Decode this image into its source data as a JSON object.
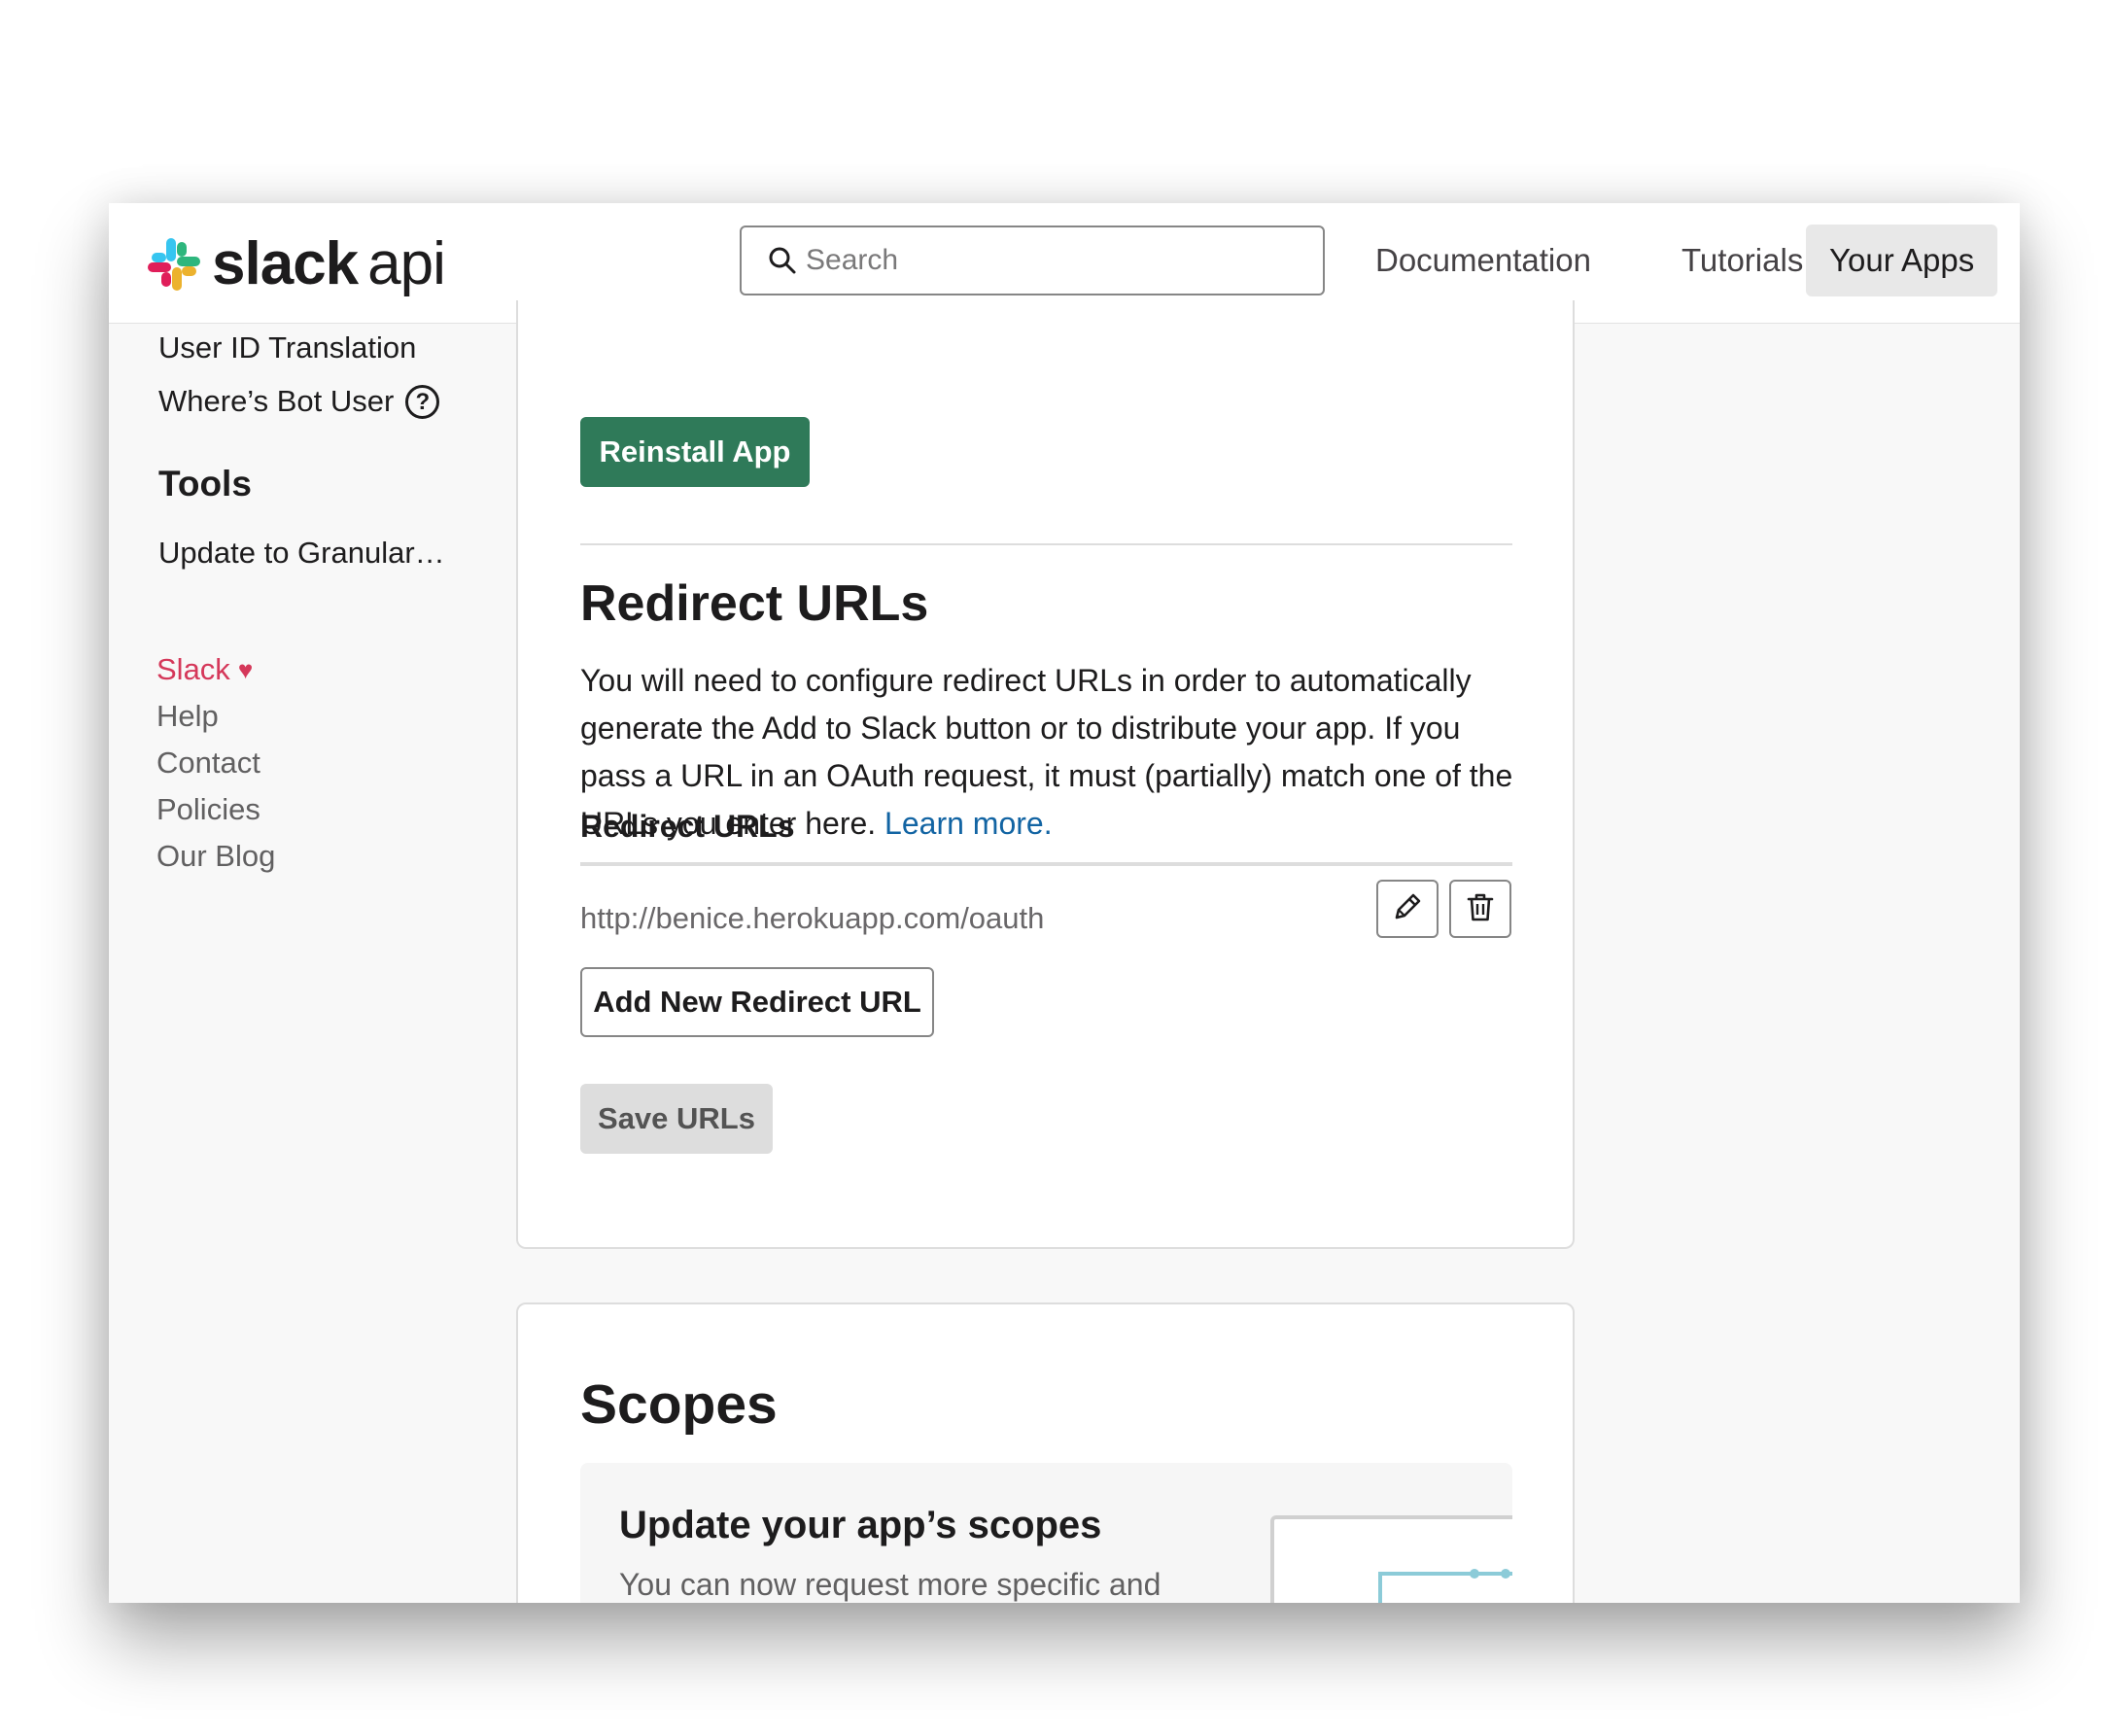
{
  "header": {
    "logo_brand": "slack",
    "logo_suffix": "api",
    "search_placeholder": "Search",
    "nav": {
      "documentation": "Documentation",
      "tutorials": "Tutorials",
      "your_apps": "Your Apps"
    }
  },
  "sidebar": {
    "items": {
      "user_id_translation": "User ID Translation",
      "wheres_bot_user": "Where’s Bot User",
      "help_icon": "?"
    },
    "tools_heading": "Tools",
    "tools_items": {
      "update_granular": "Update to Granular…"
    },
    "footer": {
      "slack": "Slack",
      "heart": "♥",
      "help": "Help",
      "contact": "Contact",
      "policies": "Policies",
      "blog": "Our Blog"
    }
  },
  "redirect_card": {
    "reinstall_button": "Reinstall App",
    "heading": "Redirect URLs",
    "description": "You will need to configure redirect URLs in order to automatically generate the Add to Slack button or to distribute your app. If you pass a URL in an OAuth request, it must (partially) match one of the URLs you enter here.",
    "learn_more": "Learn more.",
    "urls_label": "Redirect URLs",
    "urls": [
      "http://benice.herokuapp.com/oauth"
    ],
    "add_button": "Add New Redirect URL",
    "save_button": "Save URLs"
  },
  "scopes_card": {
    "heading": "Scopes",
    "panel_title": "Update your app’s scopes",
    "panel_subtitle": "You can now request more specific and"
  },
  "icons": {
    "logo": "slack-logo-icon",
    "search": "search-icon",
    "help": "question-circle-icon",
    "heart": "heart-icon",
    "edit": "pencil-icon",
    "delete": "trash-icon"
  },
  "colors": {
    "primary_button": "#2f7a59",
    "link": "#1264a3",
    "footer_slack": "#d5385a",
    "active_nav_bg": "#e8e8e8"
  }
}
